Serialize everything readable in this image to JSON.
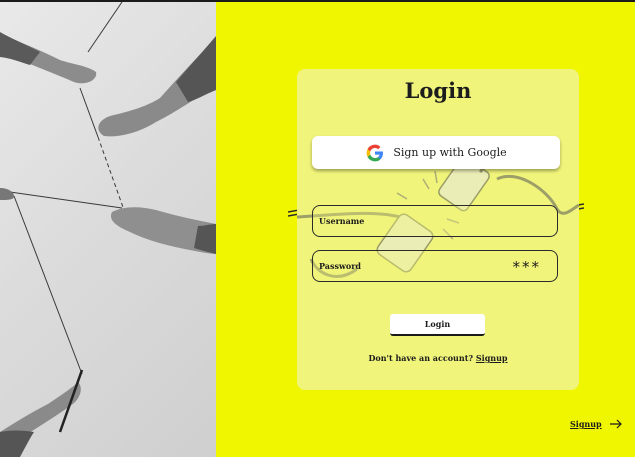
{
  "card": {
    "title": "Login",
    "google_button_label": "Sign up with Google",
    "username_label": "Username",
    "password_label": "Password",
    "password_mask": "***",
    "login_button_label": "Login",
    "no_account_text": "Don't have an account?",
    "signup_link": "Signup"
  },
  "footer": {
    "signup_label": "Signup"
  },
  "colors": {
    "background": "#f0f500",
    "card": "#f0f47a",
    "text": "#1c1c1c"
  },
  "icons": {
    "google": "google-logo-icon",
    "arrow": "arrow-right-icon"
  }
}
